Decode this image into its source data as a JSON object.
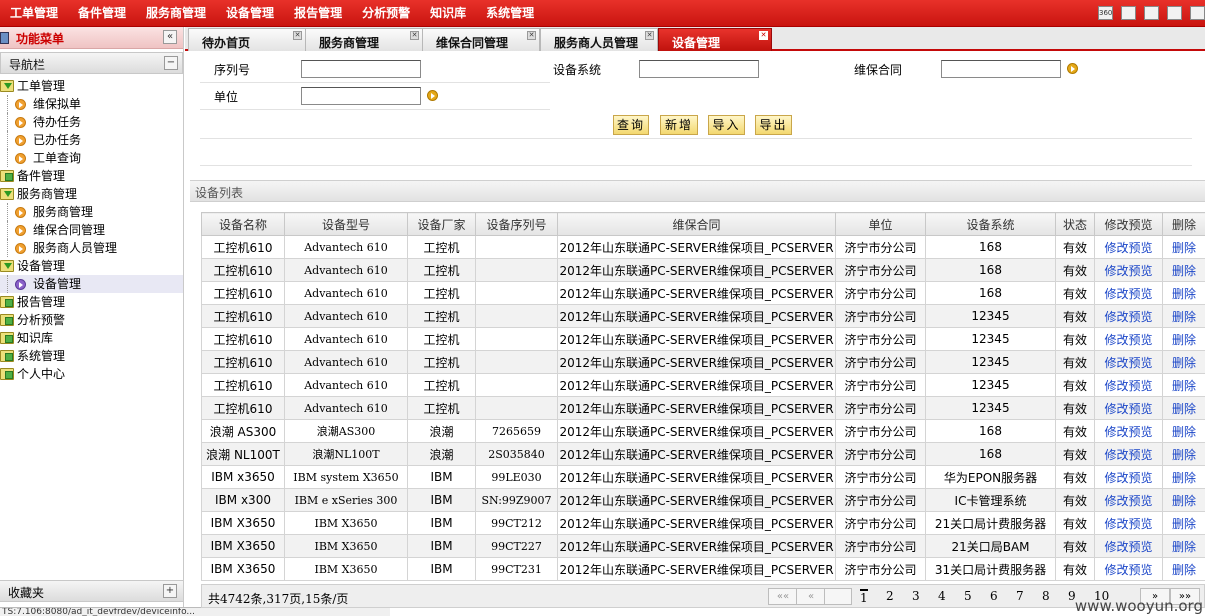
{
  "top_menu": [
    "工单管理",
    "备件管理",
    "服务商管理",
    "设备管理",
    "报告管理",
    "分析预警",
    "知识库",
    "系统管理"
  ],
  "top_icons": [
    {
      "name": "360-icon",
      "text": "360°"
    },
    {
      "name": "window-icon",
      "text": ""
    },
    {
      "name": "maximize-icon",
      "text": ""
    },
    {
      "name": "list-icon",
      "text": ""
    },
    {
      "name": "restore-icon",
      "text": ""
    }
  ],
  "sidebar": {
    "title": "功能菜单",
    "collapse_glyph": "«",
    "nav_title": "导航栏",
    "nav_collapse_glyph": "−",
    "tree": [
      {
        "label": "工单管理",
        "level": 0,
        "open": true
      },
      {
        "label": "维保拟单",
        "level": 1
      },
      {
        "label": "待办任务",
        "level": 1
      },
      {
        "label": "已办任务",
        "level": 1
      },
      {
        "label": "工单查询",
        "level": 1
      },
      {
        "label": "备件管理",
        "level": 0,
        "open": false
      },
      {
        "label": "服务商管理",
        "level": 0,
        "open": true
      },
      {
        "label": "服务商管理",
        "level": 1
      },
      {
        "label": "维保合同管理",
        "level": 1
      },
      {
        "label": "服务商人员管理",
        "level": 1
      },
      {
        "label": "设备管理",
        "level": 0,
        "open": true
      },
      {
        "label": "设备管理",
        "level": 1,
        "selected": true
      },
      {
        "label": "报告管理",
        "level": 0,
        "open": false
      },
      {
        "label": "分析预警",
        "level": 0,
        "open": false
      },
      {
        "label": "知识库",
        "level": 0,
        "open": false
      },
      {
        "label": "系统管理",
        "level": 0,
        "open": false
      },
      {
        "label": "个人中心",
        "level": 0,
        "open": false
      }
    ],
    "favorites_title": "收藏夹",
    "favorites_glyph": "+"
  },
  "status_line": "TS:7.106:8080/ad_it_devfrdev/deviceinfo...",
  "tabs": [
    {
      "label": "待办首页",
      "active": false
    },
    {
      "label": "服务商管理",
      "active": false
    },
    {
      "label": "维保合同管理",
      "active": false
    },
    {
      "label": "服务商人员管理",
      "active": false
    },
    {
      "label": "设备管理",
      "active": true
    }
  ],
  "tab_close_glyph": "✕",
  "form": {
    "serial_label": "序列号",
    "serial_value": "",
    "system_label": "设备系统",
    "system_value": "",
    "contract_label": "维保合同",
    "contract_value": "",
    "unit_label": "单位",
    "unit_value": "",
    "query_button": "查询",
    "add_button": "新增",
    "import_button": "导入",
    "export_button": "导出"
  },
  "list_title": "设备列表",
  "table": {
    "headers": [
      "设备名称",
      "设备型号",
      "设备厂家",
      "设备序列号",
      "维保合同",
      "单位",
      "设备系统",
      "状态",
      "修改预览",
      "删除"
    ],
    "rows": [
      [
        "工控机610",
        "Advantech 610",
        "工控机",
        "",
        "2012年山东联通PC-SERVER维保项目_PCSERVER",
        "济宁市分公司",
        "168",
        "有效",
        "修改预览",
        "删除"
      ],
      [
        "工控机610",
        "Advantech 610",
        "工控机",
        "",
        "2012年山东联通PC-SERVER维保项目_PCSERVER",
        "济宁市分公司",
        "168",
        "有效",
        "修改预览",
        "删除"
      ],
      [
        "工控机610",
        "Advantech 610",
        "工控机",
        "",
        "2012年山东联通PC-SERVER维保项目_PCSERVER",
        "济宁市分公司",
        "168",
        "有效",
        "修改预览",
        "删除"
      ],
      [
        "工控机610",
        "Advantech 610",
        "工控机",
        "",
        "2012年山东联通PC-SERVER维保项目_PCSERVER",
        "济宁市分公司",
        "12345",
        "有效",
        "修改预览",
        "删除"
      ],
      [
        "工控机610",
        "Advantech 610",
        "工控机",
        "",
        "2012年山东联通PC-SERVER维保项目_PCSERVER",
        "济宁市分公司",
        "12345",
        "有效",
        "修改预览",
        "删除"
      ],
      [
        "工控机610",
        "Advantech 610",
        "工控机",
        "",
        "2012年山东联通PC-SERVER维保项目_PCSERVER",
        "济宁市分公司",
        "12345",
        "有效",
        "修改预览",
        "删除"
      ],
      [
        "工控机610",
        "Advantech 610",
        "工控机",
        "",
        "2012年山东联通PC-SERVER维保项目_PCSERVER",
        "济宁市分公司",
        "12345",
        "有效",
        "修改预览",
        "删除"
      ],
      [
        "工控机610",
        "Advantech 610",
        "工控机",
        "",
        "2012年山东联通PC-SERVER维保项目_PCSERVER",
        "济宁市分公司",
        "12345",
        "有效",
        "修改预览",
        "删除"
      ],
      [
        "浪潮 AS300",
        "浪潮AS300",
        "浪潮",
        "7265659",
        "2012年山东联通PC-SERVER维保项目_PCSERVER",
        "济宁市分公司",
        "168",
        "有效",
        "修改预览",
        "删除"
      ],
      [
        "浪潮 NL100T",
        "浪潮NL100T",
        "浪潮",
        "2S035840",
        "2012年山东联通PC-SERVER维保项目_PCSERVER",
        "济宁市分公司",
        "168",
        "有效",
        "修改预览",
        "删除"
      ],
      [
        "IBM x3650",
        "IBM system X3650",
        "IBM",
        "99LE030",
        "2012年山东联通PC-SERVER维保项目_PCSERVER",
        "济宁市分公司",
        "华为EPON服务器",
        "有效",
        "修改预览",
        "删除"
      ],
      [
        "IBM x300",
        "IBM e xSeries 300",
        "IBM",
        "SN:99Z9007",
        "2012年山东联通PC-SERVER维保项目_PCSERVER",
        "济宁市分公司",
        "IC卡管理系统",
        "有效",
        "修改预览",
        "删除"
      ],
      [
        "IBM X3650",
        "IBM X3650",
        "IBM",
        "99CT212",
        "2012年山东联通PC-SERVER维保项目_PCSERVER",
        "济宁市分公司",
        "21关口局计费服务器",
        "有效",
        "修改预览",
        "删除"
      ],
      [
        "IBM X3650",
        "IBM X3650",
        "IBM",
        "99CT227",
        "2012年山东联通PC-SERVER维保项目_PCSERVER",
        "济宁市分公司",
        "21关口局BAM",
        "有效",
        "修改预览",
        "删除"
      ],
      [
        "IBM X3650",
        "IBM X3650",
        "IBM",
        "99CT231",
        "2012年山东联通PC-SERVER维保项目_PCSERVER",
        "济宁市分公司",
        "31关口局计费服务器",
        "有效",
        "修改预览",
        "删除"
      ]
    ]
  },
  "pager": {
    "summary": "共4742条,317页,15条/页",
    "first": "««",
    "prev": "«",
    "pages": [
      "1",
      "2",
      "3",
      "4",
      "5",
      "6",
      "7",
      "8",
      "9",
      "10"
    ],
    "current": "1",
    "next": "»",
    "last": "»»"
  },
  "watermark": "www.wooyun.org"
}
